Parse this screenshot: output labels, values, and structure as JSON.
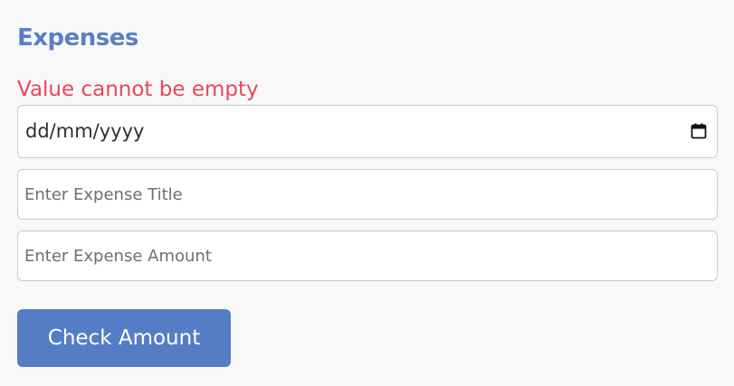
{
  "form": {
    "heading": "Expenses",
    "error_message": "Value cannot be empty",
    "date_field": {
      "display_value": "dd/mm/yyyy",
      "icon": "calendar-icon"
    },
    "title_field": {
      "value": "",
      "placeholder": "Enter Expense Title"
    },
    "amount_field": {
      "value": "",
      "placeholder": "Enter Expense Amount"
    },
    "submit_label": "Check Amount"
  },
  "colors": {
    "heading": "#5a7fc4",
    "error": "#e8475f",
    "button_bg": "#557dc6",
    "button_text": "#ffffff",
    "field_border": "#c9c9c9",
    "page_bg": "#f8f8f8"
  }
}
